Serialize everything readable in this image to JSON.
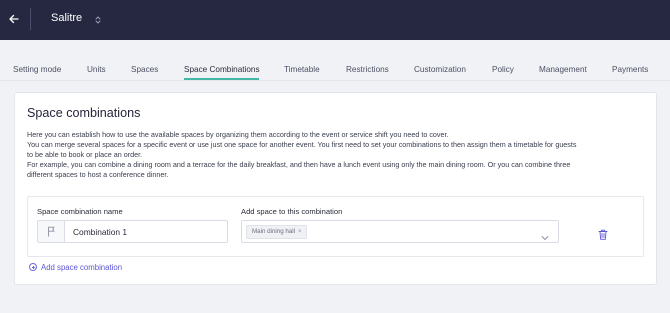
{
  "header": {
    "venue": "Salitre"
  },
  "tabs": [
    {
      "label": "Setting mode"
    },
    {
      "label": "Units"
    },
    {
      "label": "Spaces"
    },
    {
      "label": "Space Combinations",
      "active": true
    },
    {
      "label": "Timetable"
    },
    {
      "label": "Restrictions"
    },
    {
      "label": "Customization"
    },
    {
      "label": "Policy"
    },
    {
      "label": "Management"
    },
    {
      "label": "Payments"
    }
  ],
  "section": {
    "title": "Space combinations",
    "description": [
      "Here you can establish how to use the available spaces by organizing them according to the event or service shift you need to cover.",
      "You can merge several spaces for a specific event or use just one space for another event. You first need to set your combinations to then assign them a timetable for guests",
      "to be able to book or place an order.",
      "For example, you can combine a dining room and a terrace for the daily breakfast, and then have a lunch event using only the main dining room. Or you can combine three",
      "different spaces to host a conference dinner."
    ]
  },
  "combination": {
    "name_label": "Space combination name",
    "name_value": "Combination 1",
    "add_space_label": "Add space to this combination",
    "selected_spaces": [
      "Main dining hall"
    ]
  },
  "actions": {
    "add_combination": "Add space combination"
  },
  "colors": {
    "topbar": "#252840",
    "active_tab_underline": "#43b6a6",
    "link": "#5b55d6",
    "delete_icon": "#5b55d6"
  }
}
